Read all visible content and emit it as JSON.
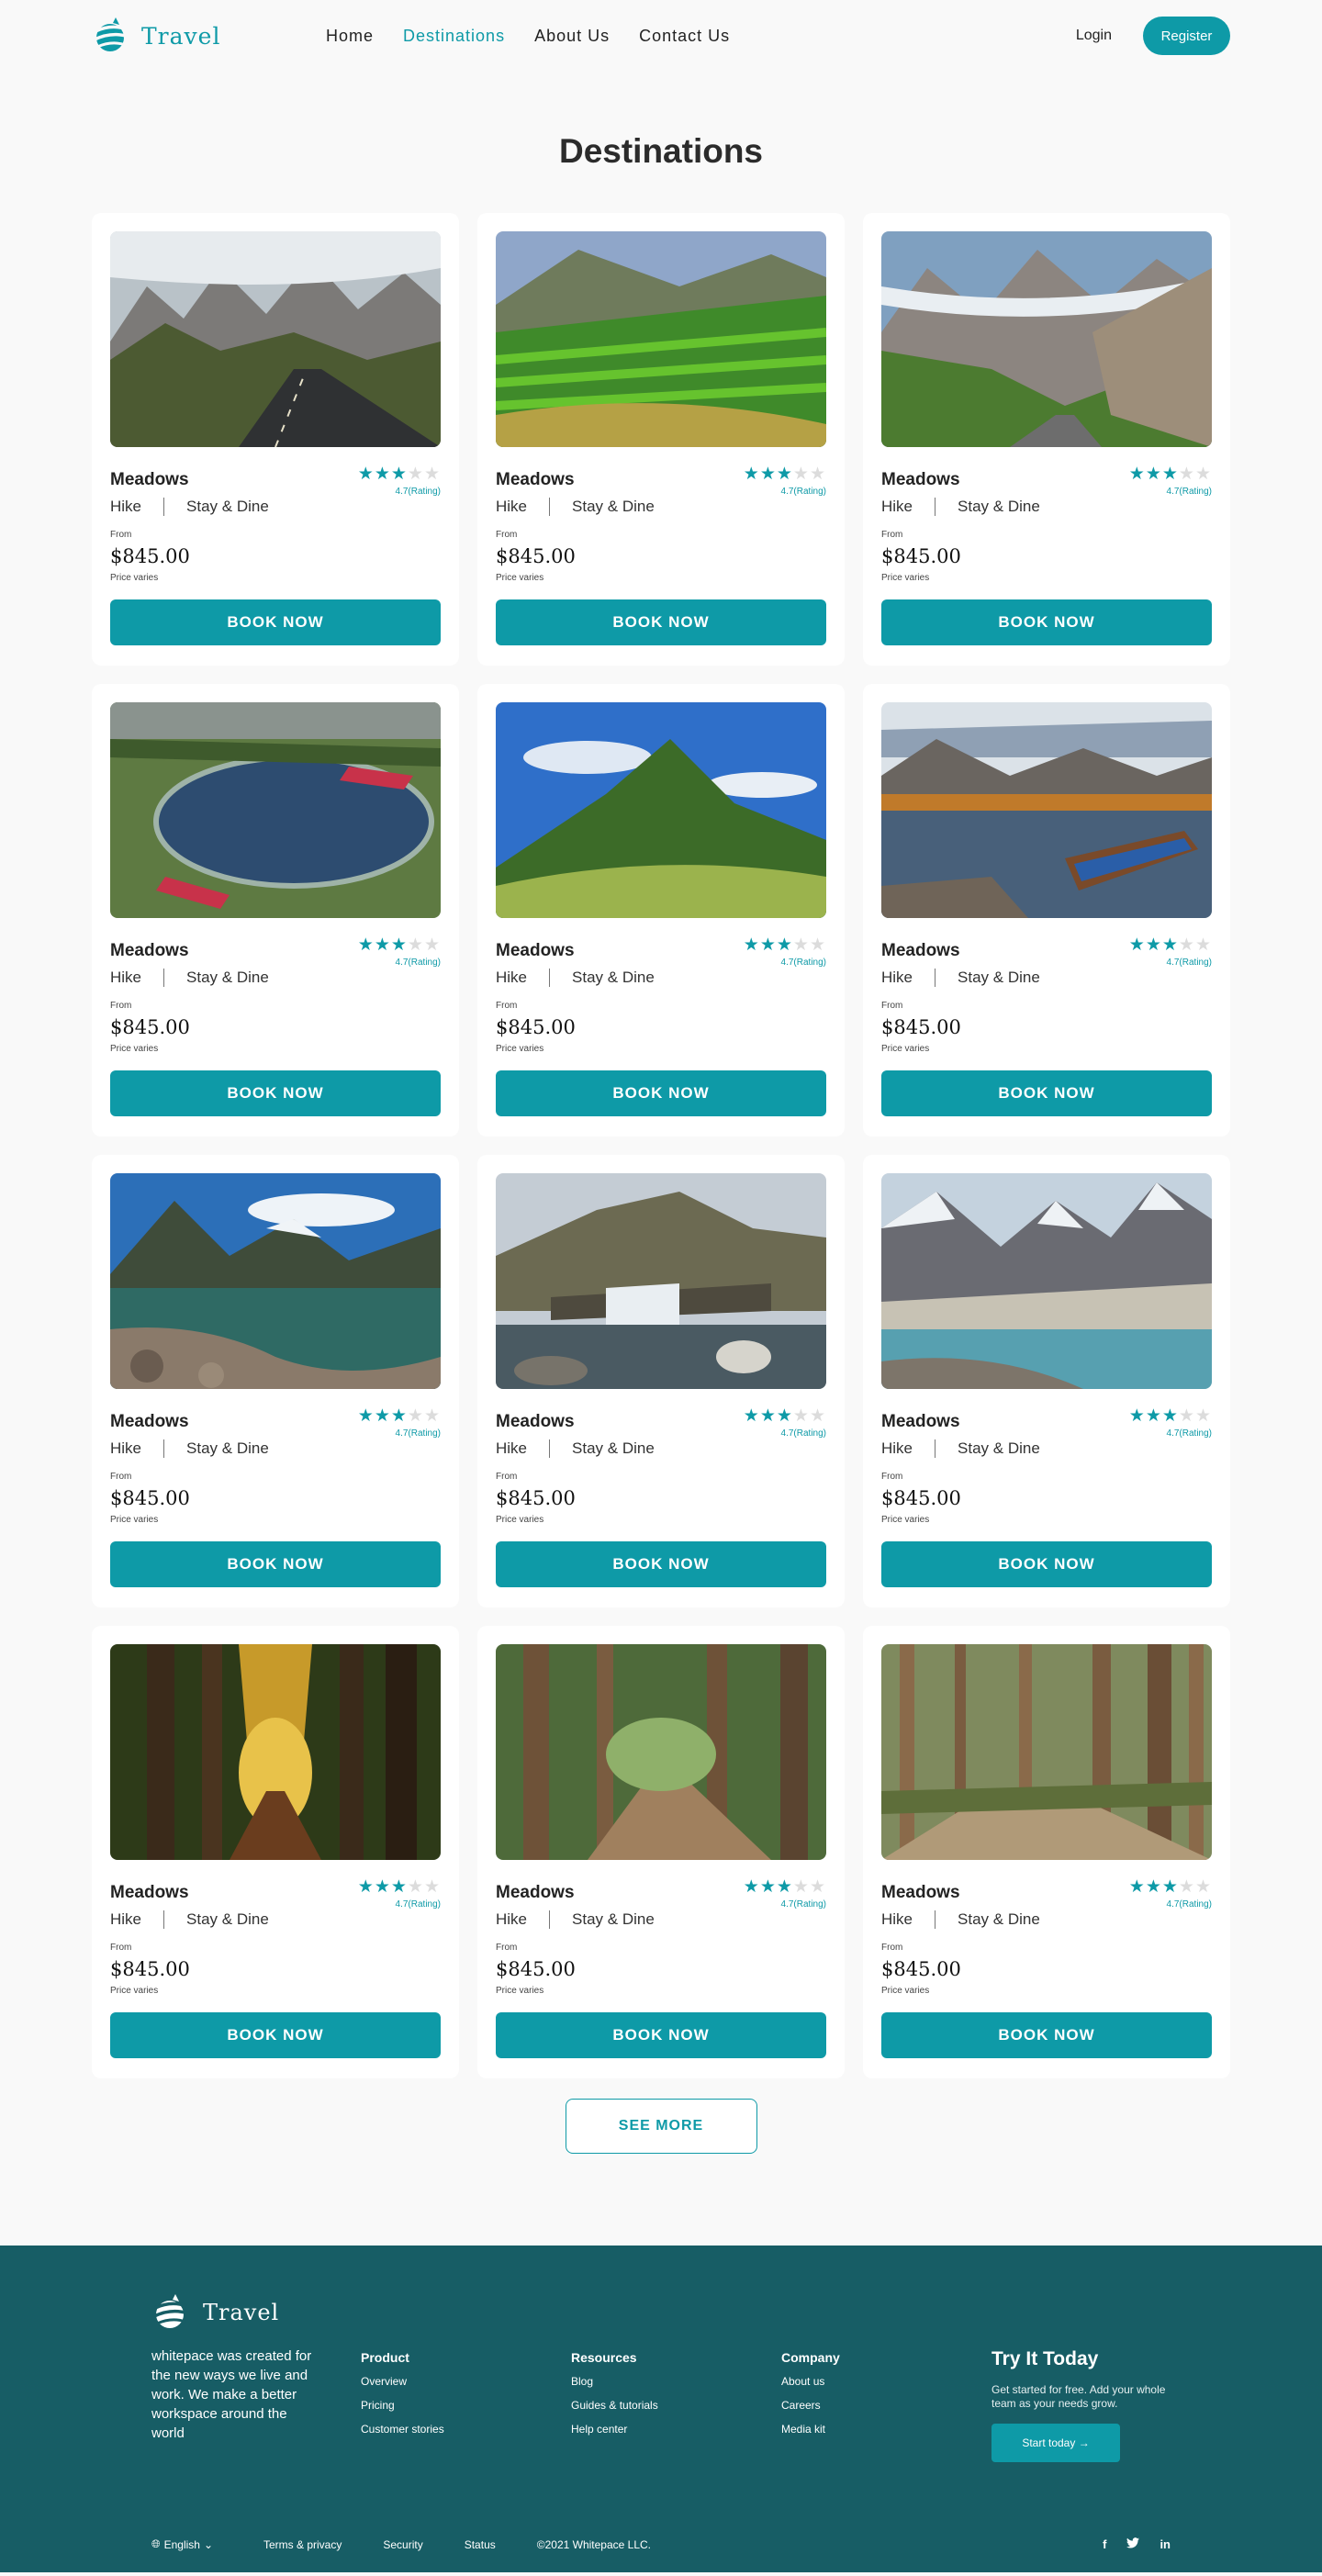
{
  "header": {
    "logo_text": "Travel",
    "nav": [
      "Home",
      "Destinations",
      "About Us",
      "Contact Us"
    ],
    "active_nav": "Destinations",
    "login": "Login",
    "register": "Register"
  },
  "page_title": "Destinations",
  "cards": [
    {
      "title": "Meadows",
      "rating": "4.7(Rating)",
      "stars": 3,
      "tag1": "Hike",
      "tag2": "Stay & Dine",
      "from": "From",
      "price": "$845.00",
      "price_note": "Price varies",
      "button": "BOOK NOW",
      "image": "mountain-road"
    },
    {
      "title": "Meadows",
      "rating": "4.7(Rating)",
      "stars": 3,
      "tag1": "Hike",
      "tag2": "Stay & Dine",
      "from": "From",
      "price": "$845.00",
      "price_note": "Price varies",
      "button": "BOOK NOW",
      "image": "green-terraces"
    },
    {
      "title": "Meadows",
      "rating": "4.7(Rating)",
      "stars": 3,
      "tag1": "Hike",
      "tag2": "Stay & Dine",
      "from": "From",
      "price": "$845.00",
      "price_note": "Price varies",
      "button": "BOOK NOW",
      "image": "valley-road"
    },
    {
      "title": "Meadows",
      "rating": "4.7(Rating)",
      "stars": 3,
      "tag1": "Hike",
      "tag2": "Stay & Dine",
      "from": "From",
      "price": "$845.00",
      "price_note": "Price varies",
      "button": "BOOK NOW",
      "image": "lake-resort"
    },
    {
      "title": "Meadows",
      "rating": "4.7(Rating)",
      "stars": 3,
      "tag1": "Hike",
      "tag2": "Stay & Dine",
      "from": "From",
      "price": "$845.00",
      "price_note": "Price varies",
      "button": "BOOK NOW",
      "image": "green-hill"
    },
    {
      "title": "Meadows",
      "rating": "4.7(Rating)",
      "stars": 3,
      "tag1": "Hike",
      "tag2": "Stay & Dine",
      "from": "From",
      "price": "$845.00",
      "price_note": "Price varies",
      "button": "BOOK NOW",
      "image": "lake-boat"
    },
    {
      "title": "Meadows",
      "rating": "4.7(Rating)",
      "stars": 3,
      "tag1": "Hike",
      "tag2": "Stay & Dine",
      "from": "From",
      "price": "$845.00",
      "price_note": "Price varies",
      "button": "BOOK NOW",
      "image": "mountain-lake"
    },
    {
      "title": "Meadows",
      "rating": "4.7(Rating)",
      "stars": 3,
      "tag1": "Hike",
      "tag2": "Stay & Dine",
      "from": "From",
      "price": "$845.00",
      "price_note": "Price varies",
      "button": "BOOK NOW",
      "image": "waterfall"
    },
    {
      "title": "Meadows",
      "rating": "4.7(Rating)",
      "stars": 3,
      "tag1": "Hike",
      "tag2": "Stay & Dine",
      "from": "From",
      "price": "$845.00",
      "price_note": "Price varies",
      "button": "BOOK NOW",
      "image": "glacier-lake"
    },
    {
      "title": "Meadows",
      "rating": "4.7(Rating)",
      "stars": 3,
      "tag1": "Hike",
      "tag2": "Stay & Dine",
      "from": "From",
      "price": "$845.00",
      "price_note": "Price varies",
      "button": "BOOK NOW",
      "image": "autumn-forest"
    },
    {
      "title": "Meadows",
      "rating": "4.7(Rating)",
      "stars": 3,
      "tag1": "Hike",
      "tag2": "Stay & Dine",
      "from": "From",
      "price": "$845.00",
      "price_note": "Price varies",
      "button": "BOOK NOW",
      "image": "forest-path"
    },
    {
      "title": "Meadows",
      "rating": "4.7(Rating)",
      "stars": 3,
      "tag1": "Hike",
      "tag2": "Stay & Dine",
      "from": "From",
      "price": "$845.00",
      "price_note": "Price varies",
      "button": "BOOK NOW",
      "image": "pine-forest"
    }
  ],
  "see_more": "SEE MORE",
  "footer": {
    "logo_text": "Travel",
    "description": "whitepace was created for the new ways we live and work. We make a better workspace around the world",
    "columns": [
      {
        "title": "Product",
        "links": [
          "Overview",
          "Pricing",
          "Customer stories"
        ]
      },
      {
        "title": "Resources",
        "links": [
          "Blog",
          "Guides & tutorials",
          "Help center"
        ]
      },
      {
        "title": "Company",
        "links": [
          "About us",
          "Careers",
          "Media kit"
        ]
      }
    ],
    "cta_title": "Try It Today",
    "cta_desc": "Get started for free. Add your whole team as your needs grow.",
    "cta_button": "Start today",
    "language": "English",
    "bottom_links": [
      "Terms & privacy",
      "Security",
      "Status"
    ],
    "copyright": "©2021 Whitepace LLC.",
    "socials": [
      "f",
      "t",
      "in"
    ]
  },
  "colors": {
    "accent": "#0e9aa7",
    "footer_bg": "#175d65",
    "page_bg": "#f9f9f9"
  }
}
